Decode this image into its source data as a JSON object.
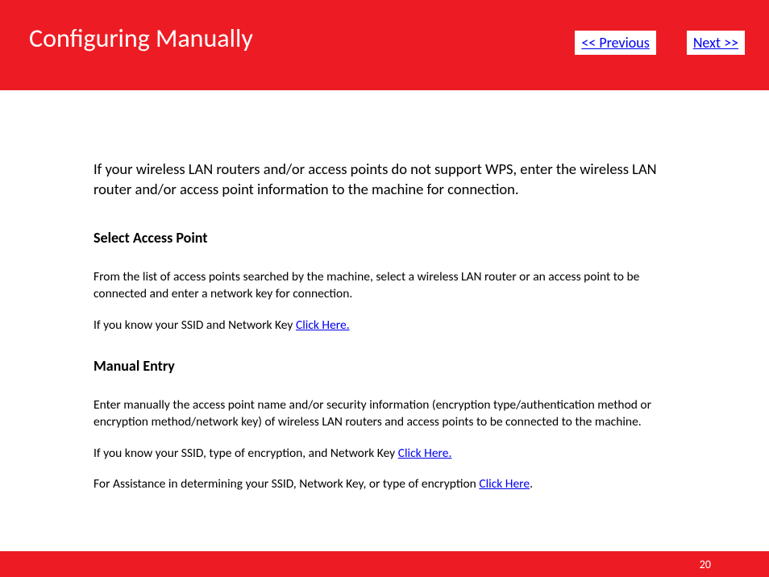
{
  "header": {
    "title": "Configuring Manually",
    "prev_label": "<< Previous",
    "next_label": "Next >>"
  },
  "intro": "If your wireless LAN routers and/or access points do not support WPS, enter the wireless LAN router and/or access point information to the machine for connection.",
  "section1": {
    "heading": "Select Access Point",
    "para1": "From the list of access points searched by the machine, select a wireless LAN router or an access point to be connected and enter a network key for connection.",
    "para2_prefix": "If you know your SSID and Network Key ",
    "para2_link": "Click Here."
  },
  "section2": {
    "heading": "Manual Entry",
    "para1": "Enter manually the access point name and/or security information (encryption type/authentication method or encryption method/network key) of wireless LAN routers and access points to be connected to the machine.",
    "para2_prefix": "If you know your SSID, type of encryption, and Network Key ",
    "para2_link": "Click Here.",
    "para3_prefix": "For Assistance in determining your SSID, Network Key, or type of encryption ",
    "para3_link": "Click Here",
    "para3_suffix": "."
  },
  "footer": {
    "page": "20"
  }
}
